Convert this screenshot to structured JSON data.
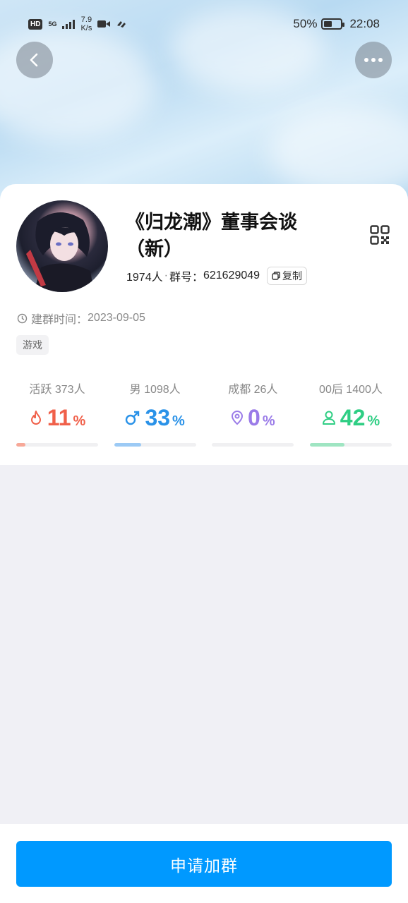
{
  "status_bar": {
    "hd": "HD",
    "network": "5G",
    "speed_value": "7.9",
    "speed_unit": "K/s",
    "battery": "50%",
    "battery_level": 0.5,
    "time": "22:08"
  },
  "header": {
    "back_icon": "chevron-left-icon",
    "more_icon": "more-dots-icon"
  },
  "group": {
    "name": "《归龙潮》董事会谈（新）",
    "members": "1974人",
    "separator": "·",
    "id_label": "群号：",
    "id_value": "621629049",
    "copy_label": "复制",
    "created_label": "建群时间：",
    "created_value": "2023-09-05",
    "tag": "游戏"
  },
  "stats": [
    {
      "label": "活跃 373人",
      "value": "11",
      "unit": "%",
      "fraction": 0.11,
      "color": "#f0604a",
      "track_color": "#f7a898",
      "icon": "flame-icon"
    },
    {
      "label": "男 1098人",
      "value": "33",
      "unit": "%",
      "fraction": 0.33,
      "color": "#2a92e8",
      "track_color": "#9ccaf5",
      "icon": "male-icon"
    },
    {
      "label": "成都 26人",
      "value": "0",
      "unit": "%",
      "fraction": 0.0,
      "color": "#9a7be8",
      "track_color": "#cdbcf5",
      "icon": "location-pin-icon"
    },
    {
      "label": "00后 1400人",
      "value": "42",
      "unit": "%",
      "fraction": 0.42,
      "color": "#2fce84",
      "track_color": "#9fe5c2",
      "icon": "person-icon"
    }
  ],
  "actions": {
    "join_label": "申请加群"
  },
  "colors": {
    "primary": "#0099ff",
    "background": "#f0f0f5"
  }
}
